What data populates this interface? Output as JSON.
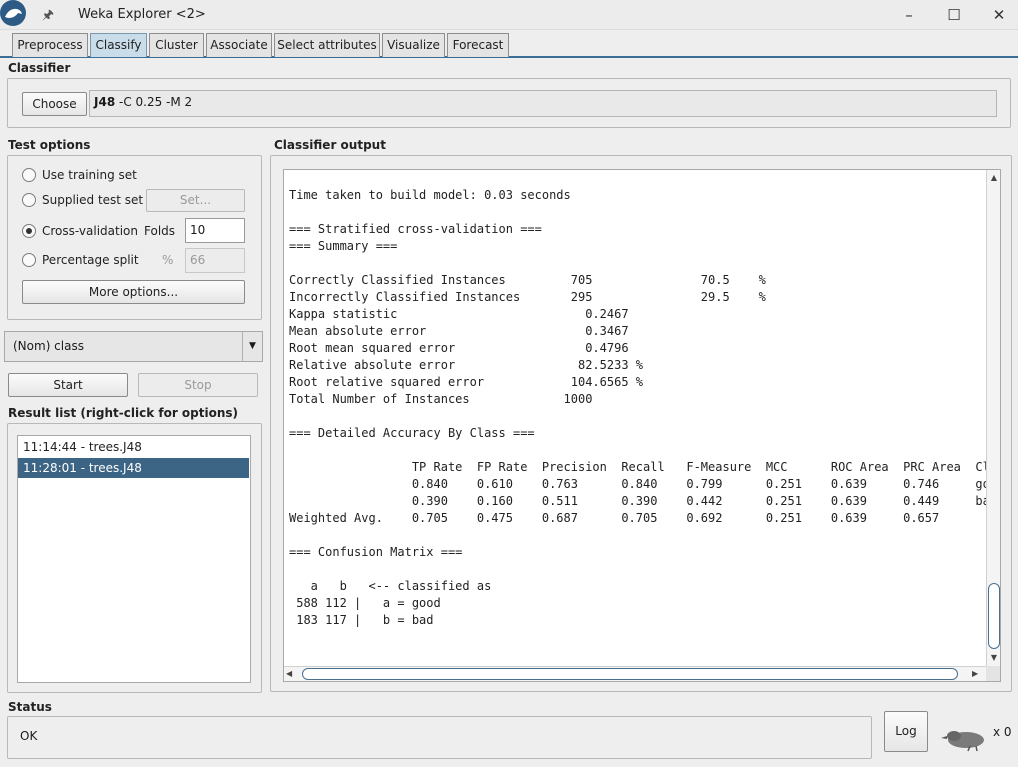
{
  "window": {
    "title": "Weka Explorer <2>"
  },
  "tabs": [
    "Preprocess",
    "Classify",
    "Cluster",
    "Associate",
    "Select attributes",
    "Visualize",
    "Forecast"
  ],
  "classifier": {
    "section_label": "Classifier",
    "choose_label": "Choose",
    "name": "J48",
    "options": " -C 0.25 -M 2"
  },
  "test_options": {
    "section_label": "Test options",
    "use_training_set": "Use training set",
    "supplied_test_set": "Supplied test set",
    "set_label": "Set...",
    "cross_validation": "Cross-validation",
    "folds_label": "Folds",
    "folds_value": "10",
    "percentage_split": "Percentage split",
    "percent_label": "%",
    "percent_value": "66",
    "more_options_label": "More options..."
  },
  "class_select": {
    "value": "(Nom) class"
  },
  "run": {
    "start_label": "Start",
    "stop_label": "Stop"
  },
  "result_list": {
    "section_label": "Result list (right-click for options)",
    "items": [
      "11:14:44 - trees.J48",
      "11:28:01 - trees.J48"
    ]
  },
  "output": {
    "section_label": "Classifier output",
    "text": "Time taken to build model: 0.03 seconds\n\n=== Stratified cross-validation ===\n=== Summary ===\n\nCorrectly Classified Instances         705               70.5    %\nIncorrectly Classified Instances       295               29.5    %\nKappa statistic                          0.2467\nMean absolute error                      0.3467\nRoot mean squared error                  0.4796\nRelative absolute error                 82.5233 %\nRoot relative squared error            104.6565 %\nTotal Number of Instances             1000     \n\n=== Detailed Accuracy By Class ===\n\n                 TP Rate  FP Rate  Precision  Recall   F-Measure  MCC      ROC Area  PRC Area  Class\n                 0.840    0.610    0.763      0.840    0.799      0.251    0.639     0.746     good\n                 0.390    0.160    0.511      0.390    0.442      0.251    0.639     0.449     bad\nWeighted Avg.    0.705    0.475    0.687      0.705    0.692      0.251    0.639     0.657     \n\n=== Confusion Matrix ===\n\n   a   b   <-- classified as\n 588 112 |   a = good\n 183 117 |   b = bad"
  },
  "status": {
    "section_label": "Status",
    "text": "OK",
    "log_label": "Log",
    "task_count": "x 0"
  }
}
